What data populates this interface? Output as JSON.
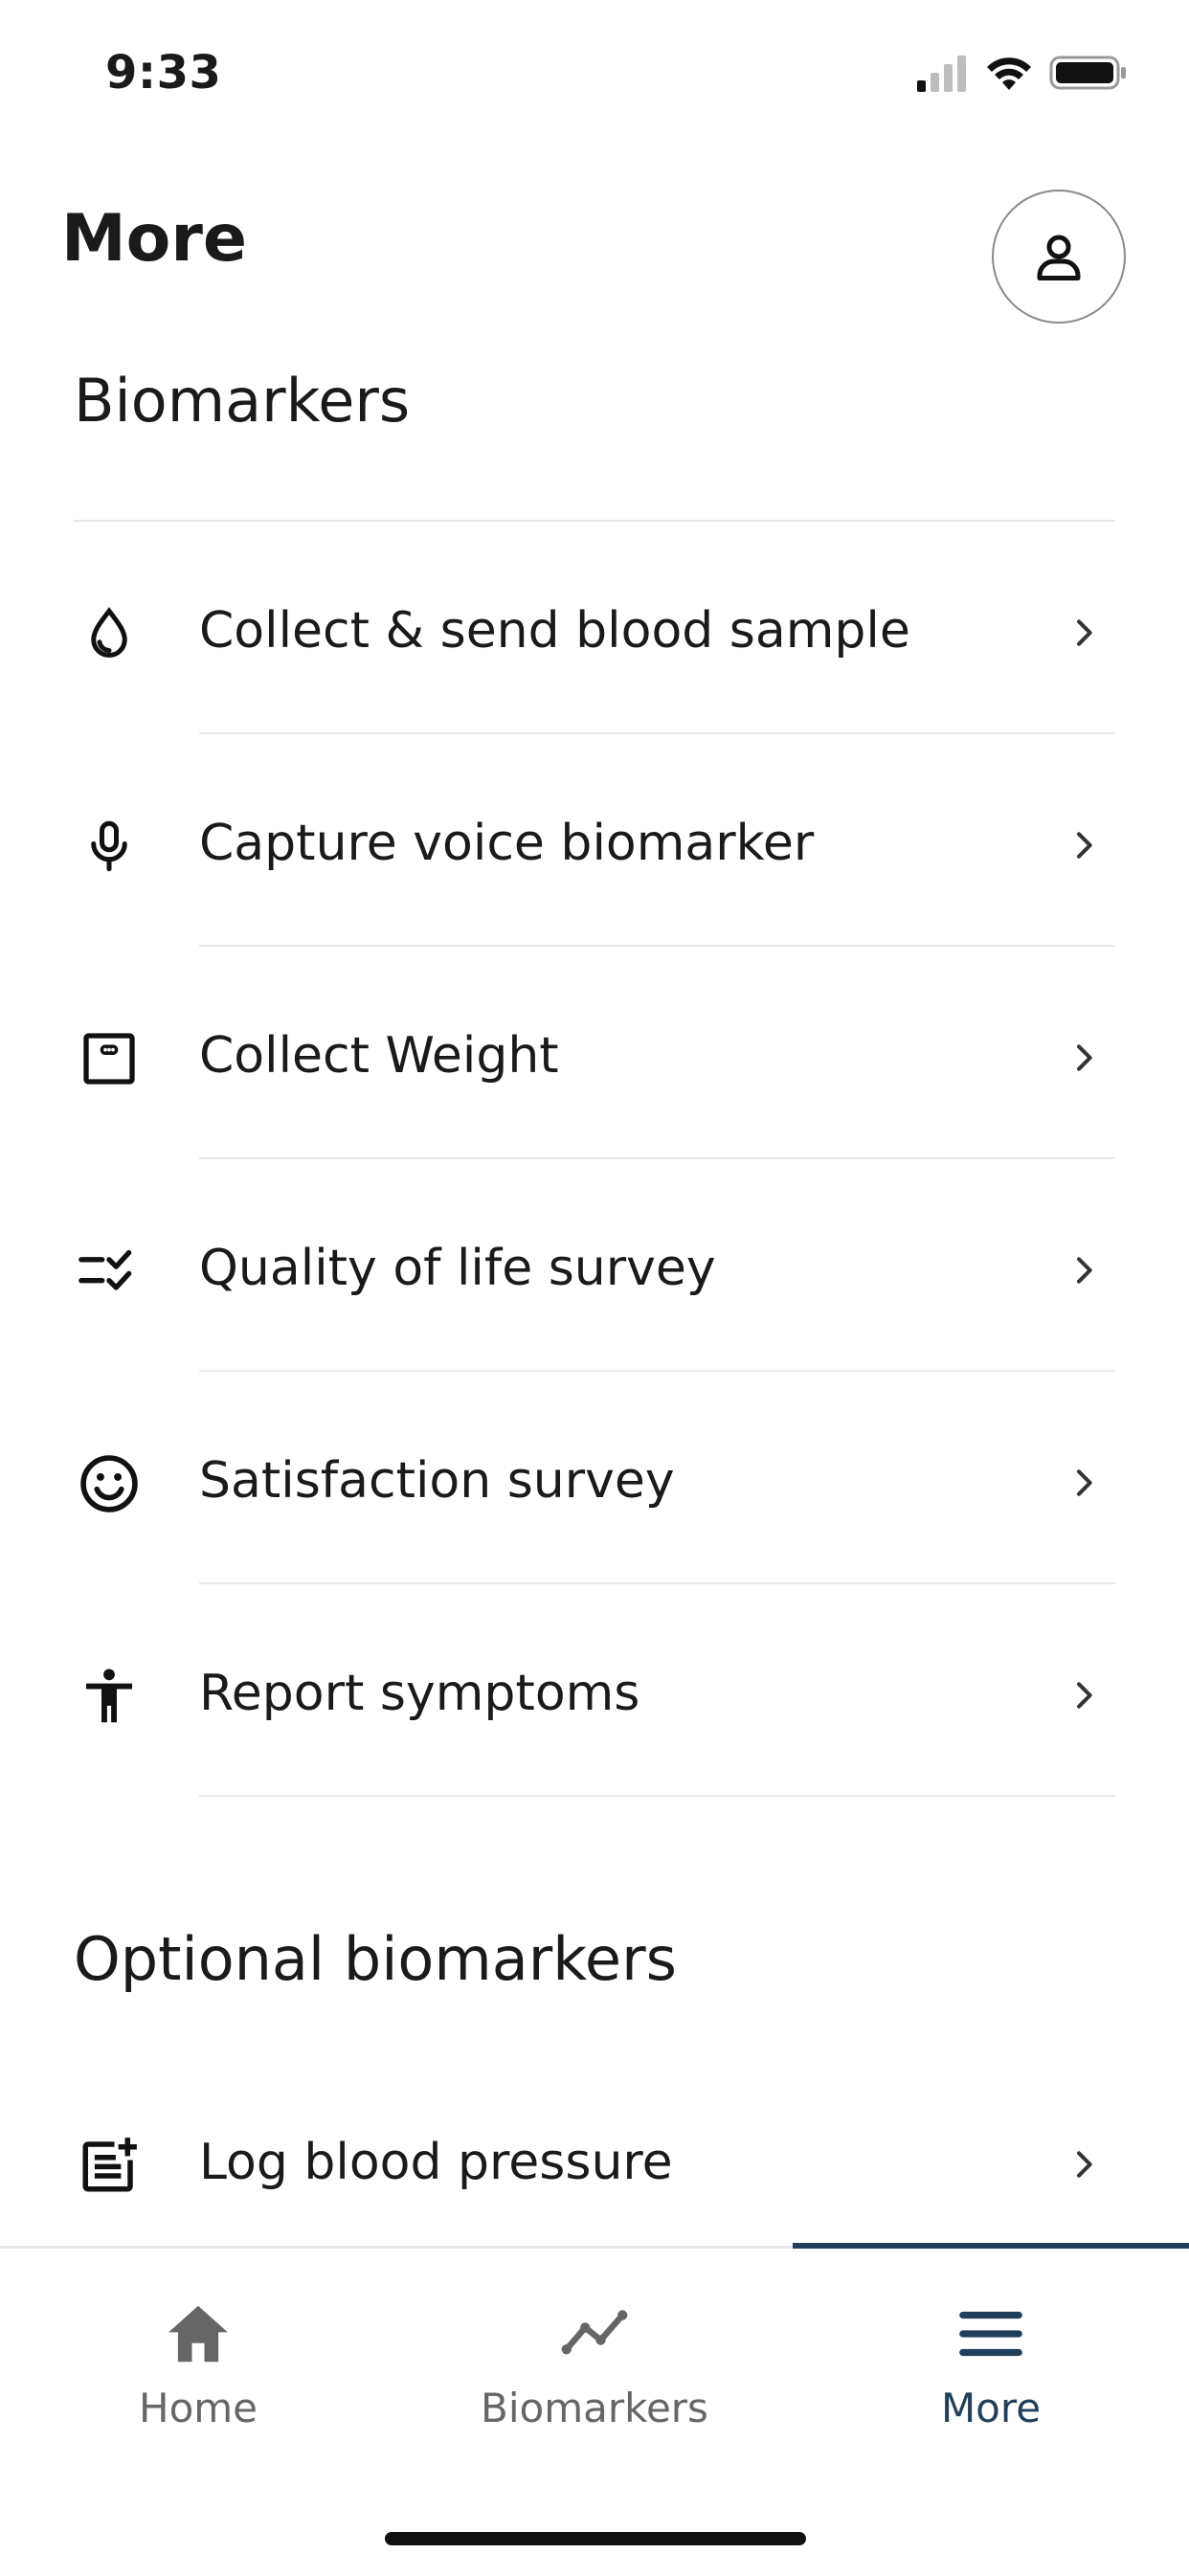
{
  "status_bar": {
    "time": "9:33"
  },
  "header": {
    "title": "More"
  },
  "sections": [
    {
      "title": "Biomarkers",
      "items": [
        {
          "label": "Collect & send blood sample",
          "icon": "drop-icon"
        },
        {
          "label": "Capture voice biomarker",
          "icon": "microphone-icon"
        },
        {
          "label": "Collect Weight",
          "icon": "scale-icon"
        },
        {
          "label": "Quality of life survey",
          "icon": "checklist-icon"
        },
        {
          "label": "Satisfaction survey",
          "icon": "smiley-icon"
        },
        {
          "label": "Report symptoms",
          "icon": "person-icon"
        }
      ]
    },
    {
      "title": "Optional biomarkers",
      "items": [
        {
          "label": "Log blood pressure",
          "icon": "note-add-icon"
        }
      ]
    }
  ],
  "tabbar": {
    "tabs": [
      {
        "label": "Home",
        "icon": "home-icon"
      },
      {
        "label": "Biomarkers",
        "icon": "trend-icon"
      },
      {
        "label": "More",
        "icon": "menu-icon",
        "active": true
      }
    ],
    "active_color": "#1f3f5b"
  }
}
